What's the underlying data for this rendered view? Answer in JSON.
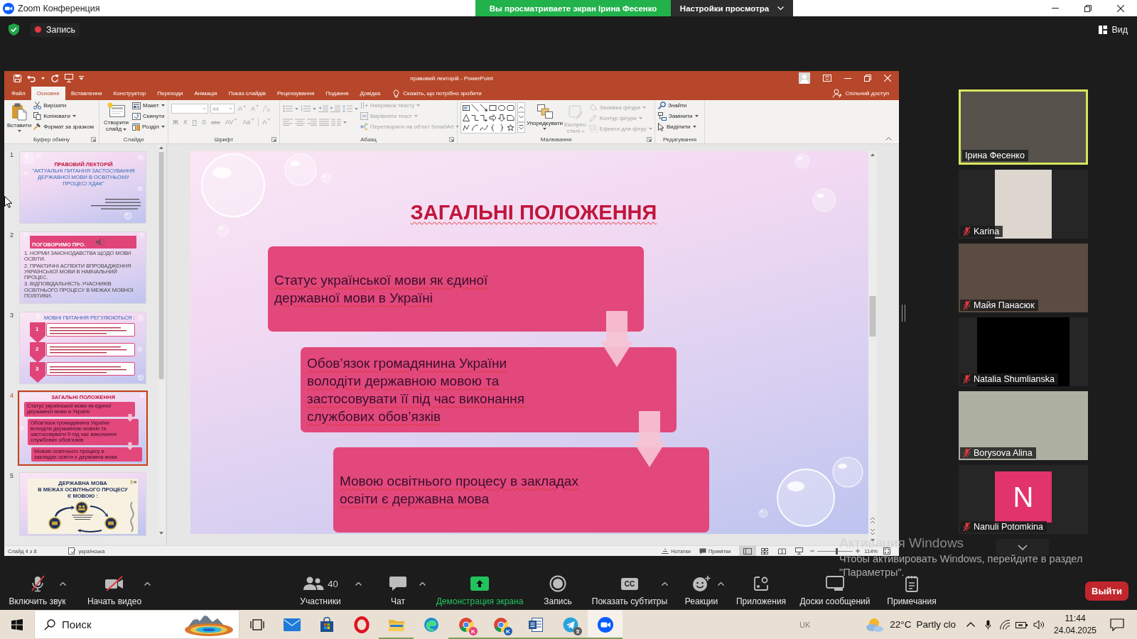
{
  "zoom_window": {
    "title": "Zoom Конференция",
    "share_banner": "Вы просматриваете экран Ірина Фесенко",
    "view_settings": "Настройки просмотра"
  },
  "meeting_bar": {
    "recording": "Запись",
    "view": "Вид"
  },
  "powerpoint": {
    "title": "правовий лекторій - PowerPoint",
    "tabs": [
      {
        "label": "Файл",
        "selected": false
      },
      {
        "label": "Основне",
        "selected": true
      },
      {
        "label": "Вставлення",
        "selected": false
      },
      {
        "label": "Конструктор",
        "selected": false
      },
      {
        "label": "Переходи",
        "selected": false
      },
      {
        "label": "Анімація",
        "selected": false
      },
      {
        "label": "Показ слайдів",
        "selected": false
      },
      {
        "label": "Рецензування",
        "selected": false
      },
      {
        "label": "Подання",
        "selected": false
      },
      {
        "label": "Довідка",
        "selected": false
      }
    ],
    "tell_me": {
      "placeholder": "Скажіть, що потрібно зробити"
    },
    "share": "Спільний доступ",
    "ribbon_groups": [
      {
        "kind": "clipboard",
        "label": "Буфер обміну",
        "large": [
          {
            "label": "Вставити",
            "disabled": false
          }
        ],
        "items": [
          {
            "label": "Вирізати",
            "disabled": false
          },
          {
            "label": "Копіювати",
            "disabled": false
          },
          {
            "label": "Формат за зразком",
            "disabled": false
          }
        ]
      },
      {
        "kind": "slides",
        "label": "Слайди",
        "large": [
          {
            "label": "Створити слайд",
            "disabled": false
          }
        ],
        "items": [
          {
            "label": "Макет",
            "disabled": false
          },
          {
            "label": "Скинути",
            "disabled": false
          },
          {
            "label": "Розділ",
            "disabled": false
          }
        ]
      },
      {
        "kind": "font",
        "label": "Шрифт",
        "disabled": true,
        "font_size": "44",
        "buttons": [
          "A",
          "A",
          "Ж",
          "К",
          "П",
          "S",
          "abc",
          "AV",
          "Aa",
          "A"
        ]
      },
      {
        "kind": "paragraph",
        "label": "Абзац",
        "disabled": true,
        "items": [
          {
            "label": "Напрямок тексту",
            "disabled": true
          },
          {
            "label": "Вирівняти текст",
            "disabled": true
          },
          {
            "label": "Перетворити на об’єкт SmartArt",
            "disabled": true
          }
        ]
      },
      {
        "kind": "drawing",
        "label": "Малювання",
        "disabled": false,
        "large": [
          {
            "label": "Упорядкувати",
            "disabled": false
          },
          {
            "label": "Експрес-стилі",
            "disabled": true
          }
        ],
        "items": [
          {
            "label": "Заливка фігури",
            "disabled": true
          },
          {
            "label": "Контур фігури",
            "disabled": true
          },
          {
            "label": "Ефекти для фігур",
            "disabled": true
          }
        ]
      },
      {
        "kind": "editing",
        "label": "Редагування",
        "items": [
          {
            "label": "Знайти",
            "disabled": false
          },
          {
            "label": "Замінити",
            "disabled": false
          },
          {
            "label": "Виділити",
            "disabled": false
          }
        ]
      }
    ],
    "thumbnails": [
      {
        "number": "1",
        "selected": false,
        "kind": "title",
        "heading": "ПРАВОВИЙ ЛЕКТОРІЙ",
        "subtitle": "\"АКТУАЛЬНІ ПИТАННЯ ЗАСТОСУВАННЯ\nДЕРЖАВНОЇ МОВИ В ОСВІТНЬОМУ\nПРОЦЕСІ ХДАК\""
      },
      {
        "number": "2",
        "selected": false,
        "kind": "agenda",
        "heading": "ПОГОВОРИМО ПРО.",
        "bullets": [
          "1. НОРМИ ЗАКОНОДАВСТВА ЩОДО МОВИ ОСВІТИ.",
          "2. ПРАКТИЧНІ АСПЕКТИ ВПРОВАДЖЕННЯ УКРАЇНСЬКОЇ МОВИ В НАВЧАЛЬНИЙ ПРОЦЕС.",
          "3. ВІДПОВІДАЛЬНІСТЬ УЧАСНИКІВ ОСВІТНЬОГО ПРОЦЕСУ В МЕЖАХ МОВНОЇ ПОЛІТИКИ."
        ]
      },
      {
        "number": "3",
        "selected": false,
        "kind": "steps",
        "heading": "МОВНІ ПИТАННЯ РЕГУЛЮЮТЬСЯ :",
        "steps": [
          "1",
          "2",
          "3"
        ]
      },
      {
        "number": "4",
        "selected": true,
        "kind": "boxes",
        "heading": "ЗАГАЛЬНІ ПОЛОЖЕННЯ",
        "boxes": [
          "Статус української мови як єдиної\nдержавної мови в Україні",
          "Обов’язок громадянина України\nволодіти державною мовою та\nзастосовувати її під час виконання\nслужбових обов’язків",
          "Мовою освітнього процесу в закладах\nосвіти є державна мова"
        ]
      },
      {
        "number": "5",
        "selected": false,
        "kind": "poster",
        "heading": "ДЕРЖАВНА МОВА\nВ МЕЖАХ ОСВІТНЬОГО ПРОЦЕСУ Є МОВОЮ :"
      }
    ],
    "slide": {
      "title": "ЗАГАЛЬНІ ПОЛОЖЕННЯ",
      "spellcheck_marks": true,
      "boxes": [
        "Статус української мови як єдиної\nдержавної мови в Україні",
        "Обов’язок громадянина України\nволодіти державною мовою та\nзастосовувати її під час виконання\nслужбових обов’язків",
        "Мовою освітнього процесу в закладах\nосвіти є державна мова"
      ]
    },
    "status_bar": {
      "slide_info": "Слайд 4 з 8",
      "language": "українська",
      "notes": "Нотатки",
      "comments": "Примітки",
      "views": [
        {
          "selected": true
        },
        {
          "selected": false
        },
        {
          "selected": false
        },
        {
          "selected": false
        }
      ],
      "zoom_slider": {
        "level": 0.55
      },
      "zoom": "114%"
    }
  },
  "participants": [
    {
      "name": "Ірина Фесенко",
      "kind": "video",
      "muted": false,
      "speaking": true
    },
    {
      "name": "Karina",
      "kind": "portrait",
      "muted": true,
      "speaking": false
    },
    {
      "name": "Майя Панасюк",
      "kind": "video",
      "muted": true,
      "speaking": false
    },
    {
      "name": "Natalia Shumlianska",
      "kind": "dark",
      "muted": true,
      "speaking": false
    },
    {
      "name": "Borysova Alina",
      "kind": "video",
      "muted": true,
      "speaking": false
    },
    {
      "name": "Nanuli Potomkina",
      "kind": "avatar",
      "initial": "N",
      "muted": true,
      "speaking": false
    }
  ],
  "toolbar": {
    "buttons": [
      {
        "label": "Включить звук",
        "caret": true,
        "active": false
      },
      {
        "label": "Начать видео",
        "caret": true,
        "active": false
      },
      {
        "label": "Участники",
        "count": "40",
        "caret": true,
        "active": false
      },
      {
        "label": "Чат",
        "caret": true,
        "active": false
      },
      {
        "label": "Демонстрация экрана",
        "caret": false,
        "active": true
      },
      {
        "label": "Запись",
        "caret": false,
        "active": false
      },
      {
        "label": "Показать субтитры",
        "icon_text": "CC",
        "caret": true,
        "active": false
      },
      {
        "label": "Реакции",
        "caret": true,
        "active": false
      },
      {
        "label": "Приложения",
        "caret": false,
        "active": false
      },
      {
        "label": "Доски сообщений",
        "caret": false,
        "active": false
      },
      {
        "label": "Примечания",
        "caret": false,
        "active": false
      }
    ],
    "leave": "Выйти"
  },
  "taskbar": {
    "search": {
      "placeholder": "Поиск"
    },
    "apps": [
      {
        "running": false,
        "selected": false
      },
      {
        "running": false,
        "selected": false
      },
      {
        "running": false,
        "selected": false
      },
      {
        "running": false,
        "selected": false
      },
      {
        "running": true,
        "selected": false
      },
      {
        "running": false,
        "selected": false
      },
      {
        "running": true,
        "selected": false,
        "badge": {
          "text": "K",
          "color": "#e4407a"
        }
      },
      {
        "running": true,
        "selected": false,
        "badge": {
          "text": "K",
          "color": "#1e5fb4"
        }
      },
      {
        "running": true,
        "selected": false
      },
      {
        "running": true,
        "selected": false,
        "badge": {
          "text": "5",
          "color": "#5c5c5c"
        }
      },
      {
        "running": true,
        "selected": true
      }
    ],
    "input_language": "UK",
    "temperature": "22°C",
    "weather": "Partly clo",
    "time": "11:44",
    "date": "24.04.2025"
  },
  "activation_notice": {
    "title": "Активация Windows",
    "text": "Чтобы активировать Windows, перейдите в раздел\n\"Параметры\"."
  }
}
